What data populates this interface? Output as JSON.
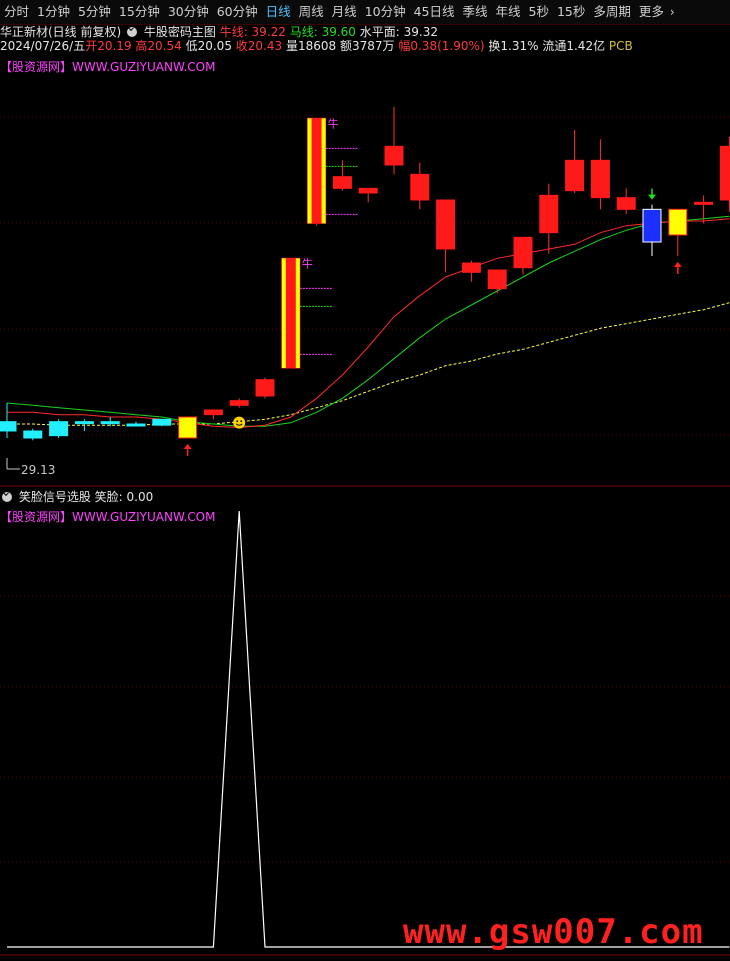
{
  "period_tabs": [
    "分时",
    "1分钟",
    "5分钟",
    "15分钟",
    "30分钟",
    "60分钟",
    "日线",
    "周线",
    "月线",
    "10分钟",
    "45日线",
    "季线",
    "年线",
    "5秒",
    "15秒",
    "多周期",
    "更多"
  ],
  "active_tab": "日线",
  "main_panel": {
    "stock_title": "华正新材(日线 前复权)",
    "indicator_name": "牛股密码主图",
    "lines": [
      {
        "label": "牛线: 39.22",
        "color": "#ff3b3b"
      },
      {
        "label": "马线: 39.60",
        "color": "#22e01c"
      },
      {
        "label": "水平面: 39.32",
        "color": "#ffff40"
      }
    ],
    "quote": {
      "date": "2024/07/26/五",
      "open": "开20.19",
      "high": "高20.54",
      "low": "低20.05",
      "close": "收20.43",
      "volume": "量18608",
      "amount": "额3787万",
      "change": "幅0.38(1.90%)",
      "turnover": "换1.31%",
      "float_cap": "流通1.42亿",
      "sector": "PCB"
    },
    "site_label": "【股资源网】WWW.GUZIYUANW.COM",
    "low_marker": "29.13",
    "bull_mark": "牛"
  },
  "sub_panel": {
    "indicator_name": "笑脸信号选股",
    "value_label": "笑脸: 0.00",
    "site_label": "【股资源网】WWW.GUZIYUANW.COM"
  },
  "watermark": "www.gsw007.com",
  "colors": {
    "up": "#ff1a1a",
    "down": "#22f0ff",
    "ma_red": "#ff2a2a",
    "ma_green": "#19d41a",
    "ma_yellow": "#ffff40",
    "signal_line": "#ffffff"
  },
  "chart_data": {
    "type": "candlestick",
    "series": [
      {
        "o": 21.0,
        "h": 21.8,
        "l": 20.3,
        "c": 20.6,
        "color": "cyan"
      },
      {
        "o": 20.6,
        "h": 20.7,
        "l": 20.2,
        "c": 20.3,
        "color": "cyan"
      },
      {
        "o": 20.4,
        "h": 21.1,
        "l": 20.3,
        "c": 21.0,
        "color": "cyan"
      },
      {
        "o": 21.0,
        "h": 21.1,
        "l": 20.6,
        "c": 21.0,
        "color": "cyan"
      },
      {
        "o": 21.0,
        "h": 21.2,
        "l": 20.8,
        "c": 21.0,
        "color": "cyan"
      },
      {
        "o": 20.85,
        "h": 21.0,
        "l": 20.8,
        "c": 20.9,
        "color": "cyan"
      },
      {
        "o": 20.85,
        "h": 21.1,
        "l": 20.8,
        "c": 21.1,
        "color": "cyan"
      },
      {
        "o": 20.3,
        "h": 21.2,
        "l": 20.3,
        "c": 21.2,
        "color": "yellow"
      },
      {
        "o": 21.3,
        "h": 21.5,
        "l": 21.1,
        "c": 21.5,
        "color": "red"
      },
      {
        "o": 21.7,
        "h": 22.0,
        "l": 21.6,
        "c": 21.9,
        "color": "red"
      },
      {
        "o": 22.1,
        "h": 22.9,
        "l": 22.0,
        "c": 22.8,
        "color": "red"
      },
      {
        "o": 23.3,
        "h": 28.0,
        "l": 23.3,
        "c": 28.0,
        "color": "redyellow"
      },
      {
        "o": 29.5,
        "h": 34.0,
        "l": 29.4,
        "c": 34.0,
        "color": "redyellow"
      },
      {
        "o": 31.5,
        "h": 32.2,
        "l": 30.9,
        "c": 31.0,
        "color": "red"
      },
      {
        "o": 31.0,
        "h": 31.0,
        "l": 30.4,
        "c": 30.8,
        "color": "red"
      },
      {
        "o": 32.0,
        "h": 34.5,
        "l": 31.6,
        "c": 32.8,
        "color": "red"
      },
      {
        "o": 31.6,
        "h": 32.1,
        "l": 30.1,
        "c": 30.5,
        "color": "red"
      },
      {
        "o": 28.4,
        "h": 30.5,
        "l": 27.4,
        "c": 30.5,
        "color": "red"
      },
      {
        "o": 27.4,
        "h": 27.9,
        "l": 27.0,
        "c": 27.8,
        "color": "red"
      },
      {
        "o": 26.7,
        "h": 27.5,
        "l": 26.5,
        "c": 27.5,
        "color": "red"
      },
      {
        "o": 27.6,
        "h": 28.9,
        "l": 27.3,
        "c": 28.9,
        "color": "red"
      },
      {
        "o": 29.1,
        "h": 31.2,
        "l": 28.2,
        "c": 30.7,
        "color": "red"
      },
      {
        "o": 30.9,
        "h": 33.5,
        "l": 30.8,
        "c": 32.2,
        "color": "red"
      },
      {
        "o": 30.6,
        "h": 33.1,
        "l": 30.1,
        "c": 32.2,
        "color": "red"
      },
      {
        "o": 30.1,
        "h": 31.0,
        "l": 29.9,
        "c": 30.6,
        "color": "red"
      },
      {
        "o": 30.1,
        "h": 30.3,
        "l": 28.1,
        "c": 28.7,
        "color": "blue"
      },
      {
        "o": 30.1,
        "h": 30.1,
        "l": 28.1,
        "c": 29.0,
        "color": "yellow"
      },
      {
        "o": 30.4,
        "h": 30.7,
        "l": 29.5,
        "c": 30.4,
        "color": "red"
      },
      {
        "o": 30.5,
        "h": 33.2,
        "l": 30.0,
        "c": 32.8,
        "color": "red"
      }
    ],
    "ma_red": [
      21.4,
      21.4,
      21.3,
      21.3,
      21.2,
      21.2,
      21.1,
      20.95,
      20.8,
      20.75,
      20.85,
      21.2,
      22.0,
      23.0,
      24.2,
      25.5,
      26.4,
      27.2,
      27.6,
      28.0,
      28.2,
      28.4,
      28.6,
      29.1,
      29.4,
      29.5,
      29.6,
      29.6,
      29.7
    ],
    "ma_green": [
      21.8,
      21.7,
      21.6,
      21.5,
      21.4,
      21.3,
      21.2,
      21.0,
      20.9,
      20.8,
      20.8,
      20.95,
      21.4,
      22.0,
      22.8,
      23.7,
      24.6,
      25.4,
      26.0,
      26.6,
      27.2,
      27.8,
      28.3,
      28.8,
      29.2,
      29.5,
      29.6,
      29.7,
      29.8
    ],
    "ma_yellow": [
      20.9,
      20.9,
      20.85,
      20.85,
      20.85,
      20.85,
      20.9,
      20.9,
      20.9,
      21.0,
      21.1,
      21.3,
      21.6,
      21.9,
      22.3,
      22.7,
      23.0,
      23.4,
      23.6,
      23.9,
      24.1,
      24.4,
      24.7,
      25.0,
      25.2,
      25.4,
      25.6,
      25.8,
      26.1
    ],
    "signal": [
      0,
      0,
      0,
      0,
      0,
      0,
      0,
      0,
      0,
      1,
      0,
      0,
      0,
      0,
      0,
      0,
      0,
      0,
      0,
      0,
      0,
      0,
      0,
      0,
      0,
      0,
      0,
      0,
      0
    ]
  }
}
